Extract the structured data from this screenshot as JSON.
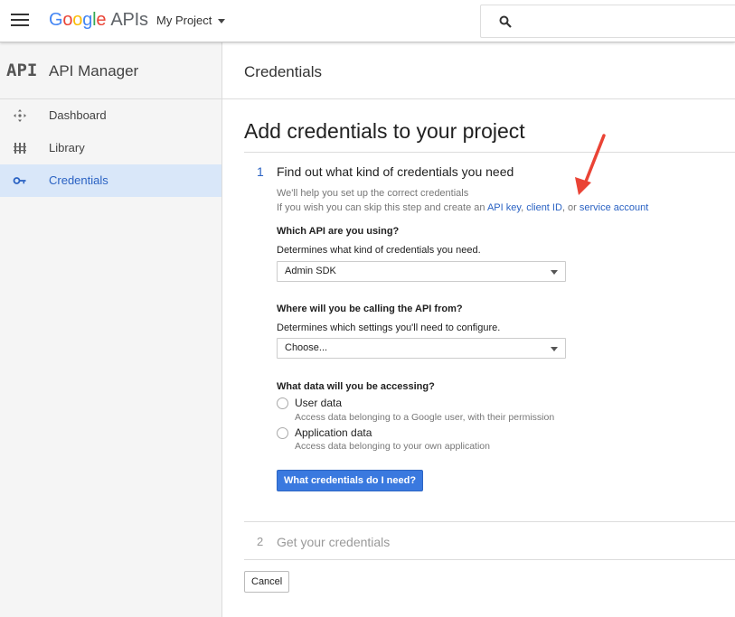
{
  "topbar": {
    "logo_letters": [
      "G",
      "o",
      "o",
      "g",
      "l",
      "e"
    ],
    "logo_suffix": "APIs",
    "project_label": "My Project"
  },
  "sidebar": {
    "badge": "API",
    "title": "API Manager",
    "items": [
      {
        "label": "Dashboard",
        "icon": "dashboard-icon",
        "active": false
      },
      {
        "label": "Library",
        "icon": "library-icon",
        "active": false
      },
      {
        "label": "Credentials",
        "icon": "key-icon",
        "active": true
      }
    ]
  },
  "main": {
    "header_title": "Credentials",
    "page_title": "Add credentials to your project",
    "step1": {
      "number": "1",
      "title": "Find out what kind of credentials you need",
      "helper_line1": "We'll help you set up the correct credentials",
      "helper_line2_prefix": "If you wish you can skip this step and create an ",
      "link_api_key": "API key",
      "sep1": ", ",
      "link_client_id": "client ID",
      "sep2": ", or ",
      "link_service_account": "service account"
    },
    "q_api": {
      "question": "Which API are you using?",
      "description": "Determines what kind of credentials you need.",
      "selected": "Admin SDK"
    },
    "q_calling": {
      "question": "Where will you be calling the API from?",
      "description": "Determines which settings you'll need to configure.",
      "selected": "Choose..."
    },
    "q_data": {
      "question": "What data will you be accessing?",
      "options": [
        {
          "label": "User data",
          "description": "Access data belonging to a Google user, with their permission"
        },
        {
          "label": "Application data",
          "description": "Access data belonging to your own application"
        }
      ]
    },
    "primary_button": "What credentials do I need?",
    "step2": {
      "number": "2",
      "title": "Get your credentials"
    },
    "cancel_button": "Cancel"
  },
  "colors": {
    "accent": "#2a62c3",
    "primary_button": "#3a79df",
    "sidebar_active": "#d9e7f9",
    "annotation_arrow": "#ea4335"
  }
}
